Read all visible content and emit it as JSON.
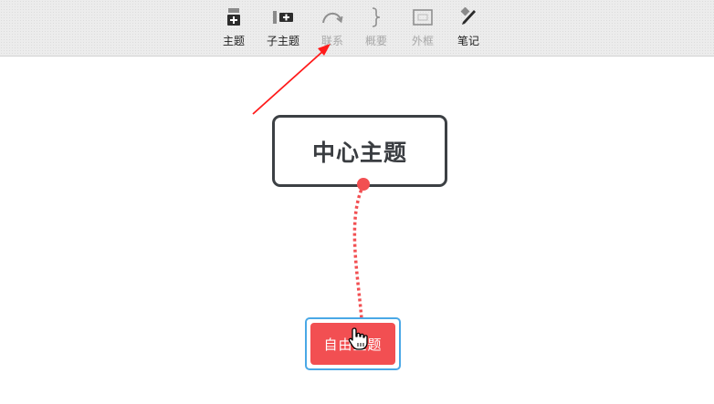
{
  "toolbar": {
    "items": [
      {
        "label": "主题",
        "icon": "topic-icon",
        "enabled": true
      },
      {
        "label": "子主题",
        "icon": "subtopic-icon",
        "enabled": true
      },
      {
        "label": "联系",
        "icon": "relationship-icon",
        "enabled": false
      },
      {
        "label": "概要",
        "icon": "summary-brace-icon",
        "enabled": false
      },
      {
        "label": "外框",
        "icon": "boundary-icon",
        "enabled": false
      },
      {
        "label": "笔记",
        "icon": "note-pencil-icon",
        "enabled": true
      }
    ]
  },
  "canvas": {
    "central_topic": "中心主题",
    "free_topic": "自由主题"
  },
  "colors": {
    "free_topic": "#f24f52",
    "selection": "#4aa8e6",
    "relationship_line": "#f24f52",
    "annotation_arrow": "#ff1a1a"
  }
}
